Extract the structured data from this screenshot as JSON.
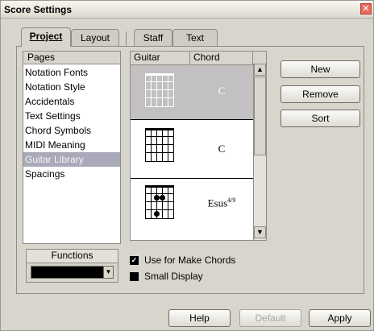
{
  "window": {
    "title": "Score Settings",
    "close_glyph": "✕"
  },
  "tabs": [
    {
      "label": "Project",
      "active": true
    },
    {
      "label": "Layout",
      "active": false
    },
    {
      "label": "Staff",
      "active": false
    },
    {
      "label": "Text",
      "active": false
    }
  ],
  "pages": {
    "header": "Pages",
    "items": [
      {
        "label": "Notation Fonts",
        "selected": false
      },
      {
        "label": "Notation Style",
        "selected": false
      },
      {
        "label": "Accidentals",
        "selected": false
      },
      {
        "label": "Text Settings",
        "selected": false
      },
      {
        "label": "Chord Symbols",
        "selected": false
      },
      {
        "label": "MIDI Meaning",
        "selected": false
      },
      {
        "label": "Guitar Library",
        "selected": true
      },
      {
        "label": "Spacings",
        "selected": false
      }
    ]
  },
  "library": {
    "columns": [
      "Guitar",
      "Chord"
    ],
    "rows": [
      {
        "chord": "C",
        "selected": true,
        "dots": 0
      },
      {
        "chord": "C",
        "selected": false,
        "dots": 0
      },
      {
        "chord": "Esus",
        "chord_sup": "4/9",
        "selected": false,
        "dots": 3
      }
    ]
  },
  "actions": {
    "new_label": "New",
    "remove_label": "Remove",
    "sort_label": "Sort"
  },
  "functions": {
    "label": "Functions",
    "selected_value": ""
  },
  "options": [
    {
      "label": "Use for Make Chords",
      "checked": true
    },
    {
      "label": "Small Display",
      "checked": false
    }
  ],
  "footer": {
    "help_label": "Help",
    "default_label": "Default",
    "apply_label": "Apply"
  },
  "colors": {
    "selection_pages": "#a9a9b9",
    "selection_row": "#c2c0c0",
    "dialog_bg": "#d8d5cc",
    "close_button": "#e86a5c"
  }
}
